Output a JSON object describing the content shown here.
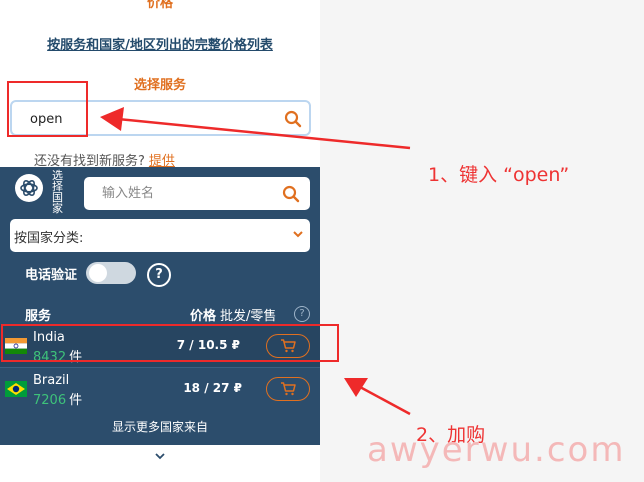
{
  "page": {
    "top_cut_text": "价格",
    "price_list_link": "按服务和国家/地区列出的完整价格列表",
    "select_service_title": "选择服务",
    "service_search_value": "open",
    "not_found_text": "还没有找到新服务?",
    "provide_link": "提供"
  },
  "country_panel": {
    "vertical_label": "选择国家",
    "search_placeholder": "输入姓名",
    "sort_label": "按国家分类:",
    "phone_verify_label": "电话验证",
    "help_symbol": "?",
    "col_service": "服务",
    "col_price": "价格",
    "col_price_sub": "批发/零售",
    "col_help_symbol": "?",
    "countries": [
      {
        "name": "India",
        "count": "8432",
        "unit": "件",
        "price": "7 / 10.5 ₽",
        "flag": "india-flag"
      },
      {
        "name": "Brazil",
        "count": "7206",
        "unit": "件",
        "price": "18 / 27 ₽",
        "flag": "brazil-flag"
      }
    ],
    "more_countries": "显示更多国家来自"
  },
  "annotations": {
    "step1": "1、键入 “open”",
    "step2": "2、加购",
    "watermark": "awyerwu.com"
  },
  "colors": {
    "accent_orange": "#e07020",
    "dark_panel": "#2c4d6c",
    "count_green": "#3ec27a",
    "annotation_red": "#ee2a2a"
  }
}
